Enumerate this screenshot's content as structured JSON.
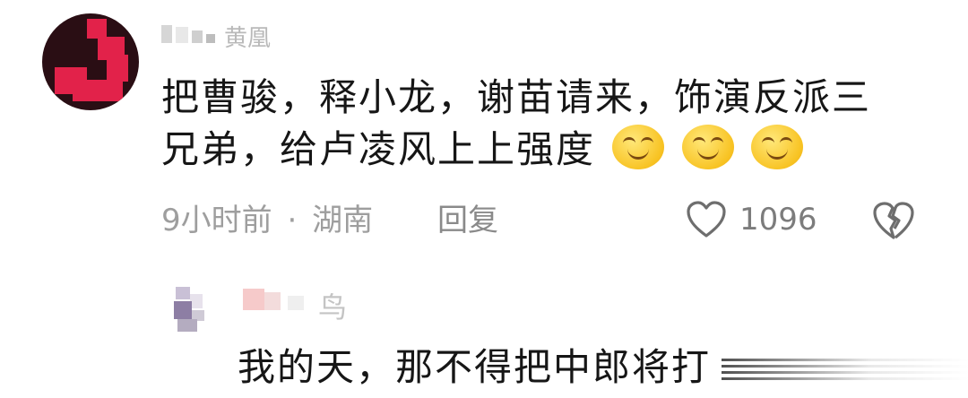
{
  "comment": {
    "username_visible": "黄凰",
    "text": "把曹骏，释小龙，谢苗请来，饰演反派三兄弟，给卢凌风上上强度",
    "emoji_count": 3,
    "emoji_icon": "smirk-emoji-icon",
    "time": "9小时前",
    "separator": "·",
    "location": "湖南",
    "reply_label": "回复",
    "like_count": "1096",
    "avatar_color": "#e2224a"
  },
  "reply": {
    "username_visible": "鸟",
    "text": "我的天，那不得把中郎将打"
  }
}
